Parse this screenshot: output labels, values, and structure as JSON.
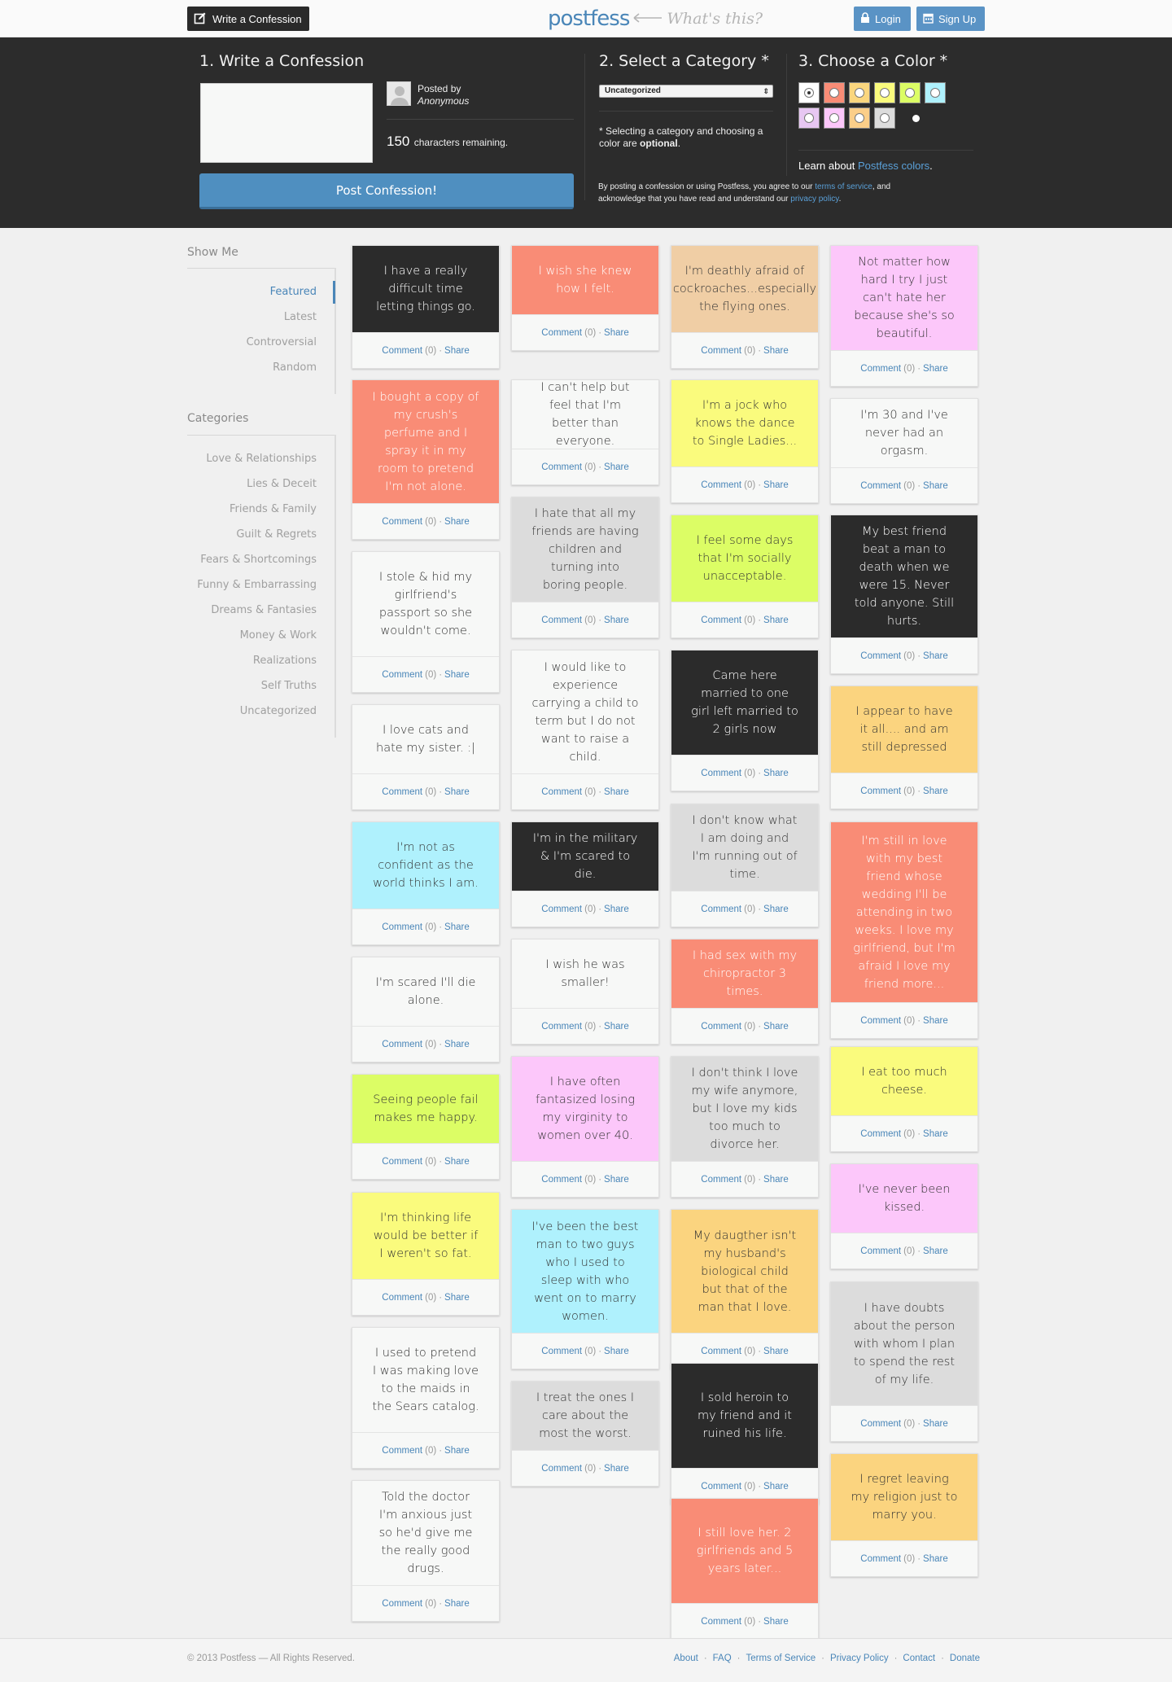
{
  "header": {
    "write_label": "Write a Confession",
    "logo": "postfess",
    "whats_this": "What's this?",
    "login_label": "Login",
    "signup_label": "Sign Up"
  },
  "composer": {
    "step1": "1. Write a Confession",
    "step2": "2. Select a Category *",
    "step3": "3. Choose a Color *",
    "posted_by": "Posted by",
    "anonymous": "Anonymous",
    "chars_count": "150",
    "chars_label": "characters remaining.",
    "post_button": "Post Confession!",
    "category_selected": "Uncategorized",
    "note_prefix": "* Selecting a category and choosing a color are ",
    "note_strong": "optional",
    "note_suffix": ".",
    "learn_prefix": "Learn about ",
    "learn_link": "Postfess colors",
    "learn_suffix": ".",
    "terms_1": "By posting a confession or using Postfess, you agree to our ",
    "terms_link1": "terms of service",
    "terms_2": ", and acknowledge that you have read and understand our ",
    "terms_link2": "privacy policy",
    "terms_3": ".",
    "colors": [
      "#ffffff",
      "#f98c76",
      "#fad67e",
      "#fafb7d",
      "#dcfd65",
      "#aff1fd",
      "#e7c7f2",
      "#fcc7fa",
      "#fbce89",
      "#dcdcdc",
      "#2b2b2b"
    ]
  },
  "sidebar": {
    "show_me_title": "Show Me",
    "show_me": [
      "Featured",
      "Latest",
      "Controversial",
      "Random"
    ],
    "categories_title": "Categories",
    "categories": [
      "Love & Relationships",
      "Lies & Deceit",
      "Friends & Family",
      "Guilt & Regrets",
      "Fears & Shortcomings",
      "Funny & Embarrassing",
      "Dreams & Fantasies",
      "Money & Work",
      "Realizations",
      "Self Truths",
      "Uncategorized"
    ]
  },
  "card_labels": {
    "comment": "Comment",
    "count": "(0)",
    "sep": "·",
    "share": "Share"
  },
  "cards": [
    {
      "text": "I have a really difficult time letting things go.",
      "bg": "#2b2b2b",
      "fg": "#ffffff"
    },
    {
      "text": "I bought a copy of my crush's perfume and I spray it in my room to pretend I'm not alone.",
      "bg": "#f98c76",
      "fg": "#ffffff"
    },
    {
      "text": "I stole & hid my girlfriend's passport so she wouldn't come.",
      "bg": "#f7f8f7",
      "fg": "#333333"
    },
    {
      "text": "I love cats and hate my sister. :|",
      "bg": "#f7f8f7",
      "fg": "#333333"
    },
    {
      "text": "I'm not as confident as the world thinks I am.",
      "bg": "#aff1fd",
      "fg": "#333333"
    },
    {
      "text": "I'm scared I'll die alone.",
      "bg": "#f7f8f7",
      "fg": "#333333"
    },
    {
      "text": "Seeing people fail makes me happy.",
      "bg": "#dcfd65",
      "fg": "#333333"
    },
    {
      "text": "I'm thinking life would be better if I weren't so fat.",
      "bg": "#fafb7d",
      "fg": "#333333"
    },
    {
      "text": "I used to pretend I was making love to the maids in the Sears catalog.",
      "bg": "#f7f8f7",
      "fg": "#333333"
    },
    {
      "text": "Told the doctor I'm anxious just so he'd give me the really good drugs.",
      "bg": "#f7f8f7",
      "fg": "#333333"
    },
    {
      "text": "I wish she knew how I felt.",
      "bg": "#f98c76",
      "fg": "#ffffff"
    },
    {
      "text": "I can't help but feel that I'm better than everyone.",
      "bg": "#f7f8f7",
      "fg": "#333333"
    },
    {
      "text": "I hate that all my friends are having children and turning into boring people.",
      "bg": "#dcdcdc",
      "fg": "#333333"
    },
    {
      "text": "I would like to experience carrying a child to term but I do not want to raise a child.",
      "bg": "#f7f8f7",
      "fg": "#333333"
    },
    {
      "text": "I'm in the military & I'm scared to die.",
      "bg": "#2b2b2b",
      "fg": "#ffffff"
    },
    {
      "text": "I wish he was smaller!",
      "bg": "#f7f8f7",
      "fg": "#333333"
    },
    {
      "text": "I have often fantasized losing my virginity to women over 40.",
      "bg": "#fcc7fa",
      "fg": "#333333"
    },
    {
      "text": "I've been the best man to two guys who I used to sleep with who went on to marry women.",
      "bg": "#aff1fd",
      "fg": "#333333"
    },
    {
      "text": "I treat the ones I care about the most the worst.",
      "bg": "#dcdcdc",
      "fg": "#333333"
    },
    {
      "text": "I'm deathly afraid of cockroaches...especially the flying ones.",
      "bg": "#f0cea5",
      "fg": "#333333"
    },
    {
      "text": "I'm a jock who knows the dance to Single Ladies...",
      "bg": "#fafb7d",
      "fg": "#333333"
    },
    {
      "text": "I feel some days that I'm socially unacceptable.",
      "bg": "#dcfd65",
      "fg": "#333333"
    },
    {
      "text": "Came here married to one girl left married to 2 girls now",
      "bg": "#2b2b2b",
      "fg": "#ffffff"
    },
    {
      "text": "I don't know what I am doing and I'm running out of time.",
      "bg": "#dcdcdc",
      "fg": "#333333"
    },
    {
      "text": "I had sex with my chiropractor 3 times.",
      "bg": "#f98c76",
      "fg": "#ffffff"
    },
    {
      "text": "I don't think I love my wife anymore, but I love my kids too much to divorce her.",
      "bg": "#dcdcdc",
      "fg": "#333333"
    },
    {
      "text": "My daugther isn't my husband's biological child but that of the man that I love.",
      "bg": "#fbd47f",
      "fg": "#333333"
    },
    {
      "text": "I sold heroin to my friend and it ruined his life.",
      "bg": "#2b2b2b",
      "fg": "#ffffff"
    },
    {
      "text": "I still love her. 2 girlfriends and 5 years later...",
      "bg": "#f98c76",
      "fg": "#ffffff"
    },
    {
      "text": "Not matter how hard I try I just can't hate her because she's so beautiful.",
      "bg": "#fcc7fa",
      "fg": "#333333"
    },
    {
      "text": "I'm 30 and I've never had an orgasm.",
      "bg": "#f7f8f7",
      "fg": "#333333"
    },
    {
      "text": "My best friend beat a man to death when we were 15. Never told anyone. Still hurts.",
      "bg": "#2b2b2b",
      "fg": "#ffffff"
    },
    {
      "text": "I appear to have it all.... and am still depressed",
      "bg": "#fbd47f",
      "fg": "#333333"
    },
    {
      "text": "I'm still in love with my best friend whose wedding I'll be attending in two weeks. I love my girlfriend, but I'm afraid I love my friend more...",
      "bg": "#f98c76",
      "fg": "#ffffff"
    },
    {
      "text": "I eat too much cheese.",
      "bg": "#fafb7d",
      "fg": "#333333"
    },
    {
      "text": "I've never been kissed.",
      "bg": "#fcc7fa",
      "fg": "#333333"
    },
    {
      "text": "I have doubts about the person with whom I plan to spend the rest of my life.",
      "bg": "#dcdcdc",
      "fg": "#333333"
    },
    {
      "text": "I regret leaving my religion just to marry you.",
      "bg": "#fbd47f",
      "fg": "#333333"
    }
  ],
  "footer": {
    "copyright": "© 2013 Postfess — All Rights Reserved.",
    "links": [
      "About",
      "FAQ",
      "Terms of Service",
      "Privacy Policy",
      "Contact",
      "Donate"
    ]
  }
}
